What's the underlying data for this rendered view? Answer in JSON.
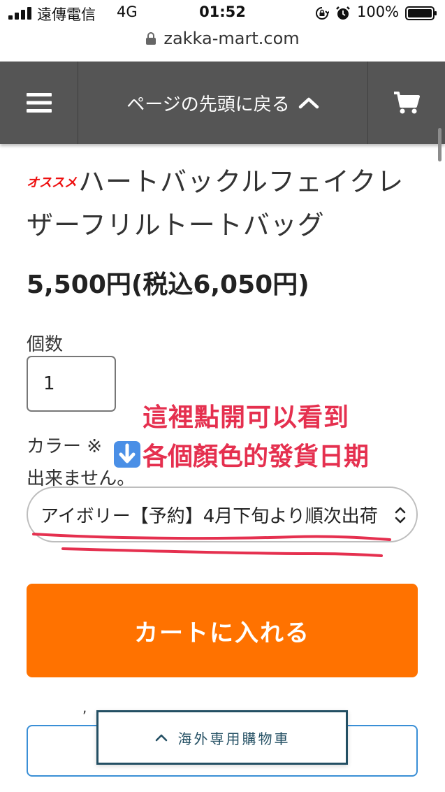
{
  "status_bar": {
    "carrier": "遠傳電信",
    "network": "4G",
    "time": "01:52",
    "battery": "100%"
  },
  "browser": {
    "url": "zakka-mart.com"
  },
  "nav": {
    "back_to_top": "ページの先頭に戻る",
    "menu_icon": "hamburger-icon",
    "cart_icon": "cart-icon"
  },
  "product": {
    "badge": "オススメ",
    "title": "ハートバックルフェイクレザーフリルトートバッグ",
    "price": "5,500円(税込6,050円)",
    "quantity_label": "個数",
    "quantity_value": "1",
    "color_note_start": "カラー ※",
    "color_note_end": "出来ません。",
    "color_selected": "アイボリー【予約】4月下旬より順次出荷"
  },
  "annotation": {
    "line1": "這裡點開可以看到",
    "line2": "各個顏色的發貨日期",
    "arrow_icon": "down-arrow-icon",
    "underline_color": "#e5304f"
  },
  "actions": {
    "add_to_cart": "カートに入れる",
    "comma": ",",
    "overseas_cart": "海外専用購物車"
  },
  "colors": {
    "accent": "#ff7200",
    "nav_bg": "#555555",
    "overseas_border": "#234f63",
    "annotation": "#e5304f"
  }
}
